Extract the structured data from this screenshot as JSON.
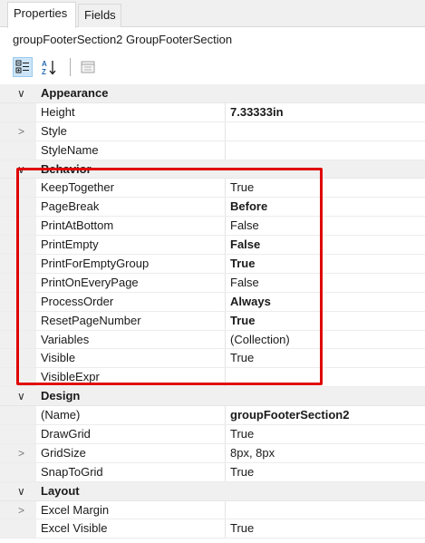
{
  "tabs": [
    {
      "label": "Properties",
      "active": true
    },
    {
      "label": "Fields",
      "active": false
    }
  ],
  "object_name": "groupFooterSection2 GroupFooterSection",
  "toolbar": {
    "categorized_icon": "categorized-view-icon",
    "alphabetical_icon": "alphabetical-sort-icon",
    "property_pages_icon": "property-pages-icon"
  },
  "colors": {
    "highlight": "#e00000",
    "selected_button": "#cce4f7"
  },
  "grid": {
    "appearance": {
      "label": "Appearance",
      "rows": [
        {
          "name": "Height",
          "value": "7.33333in",
          "bold": true
        },
        {
          "name": "Style",
          "value": "",
          "expandable": true
        },
        {
          "name": "StyleName",
          "value": ""
        }
      ]
    },
    "behavior": {
      "label": "Behavior",
      "rows": [
        {
          "name": "KeepTogether",
          "value": "True"
        },
        {
          "name": "PageBreak",
          "value": "Before",
          "bold": true
        },
        {
          "name": "PrintAtBottom",
          "value": "False"
        },
        {
          "name": "PrintEmpty",
          "value": "False",
          "bold": true
        },
        {
          "name": "PrintForEmptyGroup",
          "value": "True",
          "bold": true
        },
        {
          "name": "PrintOnEveryPage",
          "value": "False"
        },
        {
          "name": "ProcessOrder",
          "value": "Always",
          "bold": true
        },
        {
          "name": "ResetPageNumber",
          "value": "True",
          "bold": true
        },
        {
          "name": "Variables",
          "value": "(Collection)"
        },
        {
          "name": "Visible",
          "value": "True"
        },
        {
          "name": "VisibleExpr",
          "value": ""
        }
      ]
    },
    "design": {
      "label": "Design",
      "rows": [
        {
          "name": "(Name)",
          "value": "groupFooterSection2",
          "bold": true
        },
        {
          "name": "DrawGrid",
          "value": "True"
        },
        {
          "name": "GridSize",
          "value": "8px, 8px",
          "expandable": true
        },
        {
          "name": "SnapToGrid",
          "value": "True"
        }
      ]
    },
    "layout": {
      "label": "Layout",
      "rows": [
        {
          "name": "Excel Margin",
          "value": "",
          "expandable": true
        },
        {
          "name": "Excel Visible",
          "value": "True"
        }
      ]
    }
  }
}
